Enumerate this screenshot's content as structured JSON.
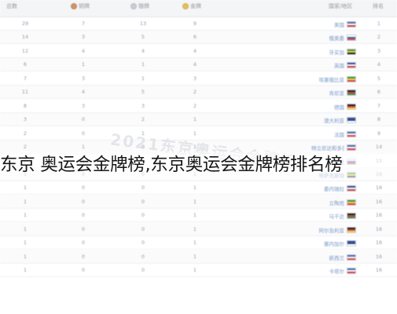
{
  "header": {
    "total_label": "总数",
    "bronze_label": "铜牌",
    "silver_label": "银牌",
    "gold_label": "金牌",
    "country_label": "国家/地区",
    "rank_label": "排名"
  },
  "colors": {
    "gold": "#e5b94a",
    "silver": "#c4c9d0",
    "bronze": "#c98b5a",
    "link": "#6d8fc0"
  },
  "rows": [
    {
      "rank": "1",
      "country": "美国",
      "gold": "9",
      "silver": "13",
      "bronze": "7",
      "total": "29"
    },
    {
      "rank": "2",
      "country": "俄奥委",
      "gold": "6",
      "silver": "5",
      "bronze": "3",
      "total": "14"
    },
    {
      "rank": "3",
      "country": "牙买加",
      "gold": "4",
      "silver": "4",
      "bronze": "4",
      "total": "12"
    },
    {
      "rank": "4",
      "country": "英国",
      "gold": "4",
      "silver": "1",
      "bronze": "1",
      "total": "6"
    },
    {
      "rank": "5",
      "country": "埃塞俄比亚",
      "gold": "3",
      "silver": "1",
      "bronze": "3",
      "total": "7"
    },
    {
      "rank": "6",
      "country": "肯尼亚",
      "gold": "2",
      "silver": "5",
      "bronze": "4",
      "total": "11"
    },
    {
      "rank": "7",
      "country": "德国",
      "gold": "2",
      "silver": "3",
      "bronze": "3",
      "total": "8"
    },
    {
      "rank": "8",
      "country": "澳大利亚",
      "gold": "1",
      "silver": "2",
      "bronze": "0",
      "total": "3"
    },
    {
      "rank": "9",
      "country": "法国",
      "gold": "1",
      "silver": "1",
      "bronze": "0",
      "total": "2"
    },
    {
      "rank": "14",
      "country": "特立尼达和多巴哥",
      "gold": "1",
      "silver": "0",
      "bronze": "1",
      "total": "2"
    },
    {
      "rank": "15",
      "country": "捷克",
      "gold": "1",
      "silver": "0",
      "bronze": "1",
      "total": "2"
    },
    {
      "rank": "16",
      "country": "哈萨克斯坦",
      "gold": "1",
      "silver": "0",
      "bronze": "0",
      "total": "1"
    },
    {
      "rank": "16",
      "country": "委内瑞拉",
      "gold": "1",
      "silver": "0",
      "bronze": "0",
      "total": "1"
    },
    {
      "rank": "16",
      "country": "立陶宛",
      "gold": "1",
      "silver": "0",
      "bronze": "0",
      "total": "1"
    },
    {
      "rank": "16",
      "country": "乌干达",
      "gold": "1",
      "silver": "0",
      "bronze": "0",
      "total": "1"
    },
    {
      "rank": "16",
      "country": "阿尔及利亚",
      "gold": "1",
      "silver": "0",
      "bronze": "0",
      "total": "1"
    },
    {
      "rank": "16",
      "country": "塞内加尔",
      "gold": "1",
      "silver": "0",
      "bronze": "0",
      "total": "1"
    },
    {
      "rank": "16",
      "country": "新西兰",
      "gold": "1",
      "silver": "0",
      "bronze": "0",
      "total": "1"
    },
    {
      "rank": "16",
      "country": "卡塔尔",
      "gold": "1",
      "silver": "0",
      "bronze": "0",
      "total": "1"
    }
  ],
  "watermark": "2021东京奥运会金牌榜",
  "caption": "东京 奥运会金牌榜,东京奥运会金牌榜排名榜"
}
